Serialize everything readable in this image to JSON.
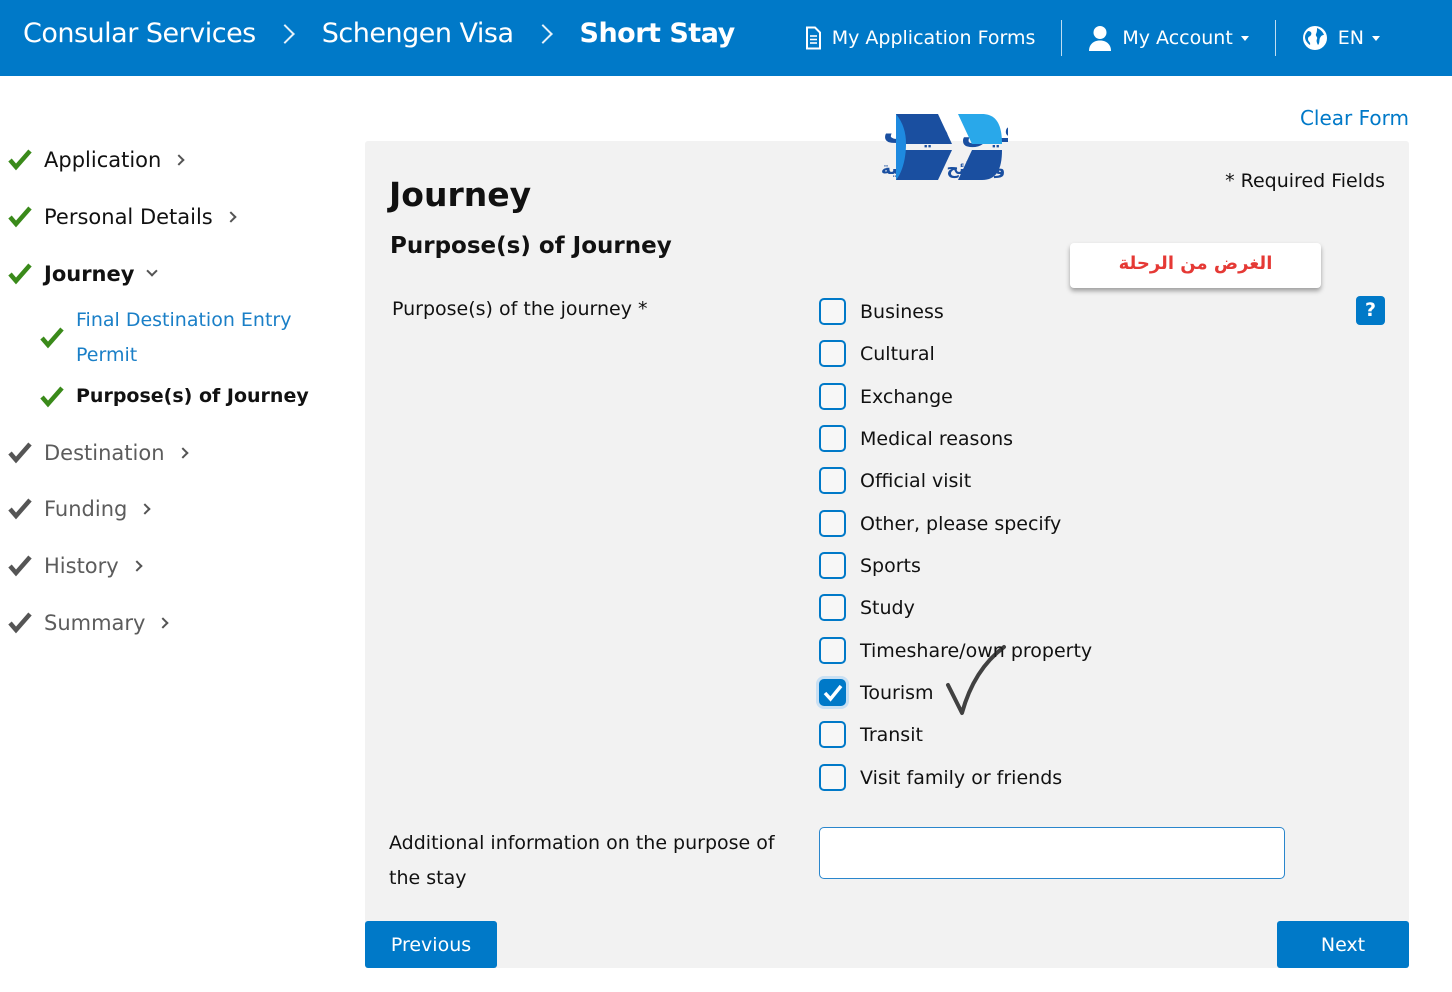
{
  "header": {
    "breadcrumbs": [
      {
        "label": "Consular Services",
        "current": false
      },
      {
        "label": "Schengen Visa",
        "current": false
      },
      {
        "label": "Short Stay",
        "current": true
      }
    ],
    "nav": {
      "forms": {
        "label": "My Application Forms",
        "icon": "document-icon"
      },
      "account": {
        "label": "My Account",
        "icon": "user-icon"
      },
      "language": {
        "label": "EN",
        "icon": "globe-icon"
      }
    },
    "brand_color": "#0079c8"
  },
  "sidebar": {
    "items": [
      {
        "label": "Application",
        "status": "done",
        "expanded": false
      },
      {
        "label": "Personal Details",
        "status": "done",
        "expanded": false
      },
      {
        "label": "Journey",
        "status": "done",
        "expanded": true,
        "children": [
          {
            "label_line1": "Final Destination Entry",
            "label_line2": "Permit",
            "status": "done",
            "current": false
          },
          {
            "label": "Purpose(s) of Journey",
            "status": "done",
            "current": true
          }
        ]
      },
      {
        "label": "Destination",
        "status": "pending",
        "expanded": false
      },
      {
        "label": "Funding",
        "status": "pending",
        "expanded": false
      },
      {
        "label": "History",
        "status": "pending",
        "expanded": false
      },
      {
        "label": "Summary",
        "status": "pending",
        "expanded": false
      }
    ],
    "done_color": "#3a8a1a",
    "pending_color": "#555555"
  },
  "watermark": {
    "title_ar": "ترافيل ديف",
    "subtitle_ar": "دروس ونصائح سياحية"
  },
  "main": {
    "clear_form": "Clear Form",
    "title": "Journey",
    "required_note": "* Required Fields",
    "section_title": "Purpose(s) of Journey",
    "annotation_ar": "الغرض من الرحلة",
    "help_label": "?",
    "purpose_field": {
      "label": "Purpose(s) of the journey *",
      "options": [
        {
          "label": "Business",
          "checked": false
        },
        {
          "label": "Cultural",
          "checked": false
        },
        {
          "label": "Exchange",
          "checked": false
        },
        {
          "label": "Medical reasons",
          "checked": false
        },
        {
          "label": "Official visit",
          "checked": false
        },
        {
          "label": "Other, please specify",
          "checked": false
        },
        {
          "label": "Sports",
          "checked": false
        },
        {
          "label": "Study",
          "checked": false
        },
        {
          "label": "Timeshare/own property",
          "checked": false
        },
        {
          "label": "Tourism",
          "checked": true
        },
        {
          "label": "Transit",
          "checked": false
        },
        {
          "label": "Visit family or friends",
          "checked": false
        }
      ]
    },
    "additional_info": {
      "label_line1": "Additional information on the purpose of",
      "label_line2": "the stay",
      "value": "",
      "placeholder": ""
    },
    "buttons": {
      "previous": "Previous",
      "next": "Next"
    }
  }
}
